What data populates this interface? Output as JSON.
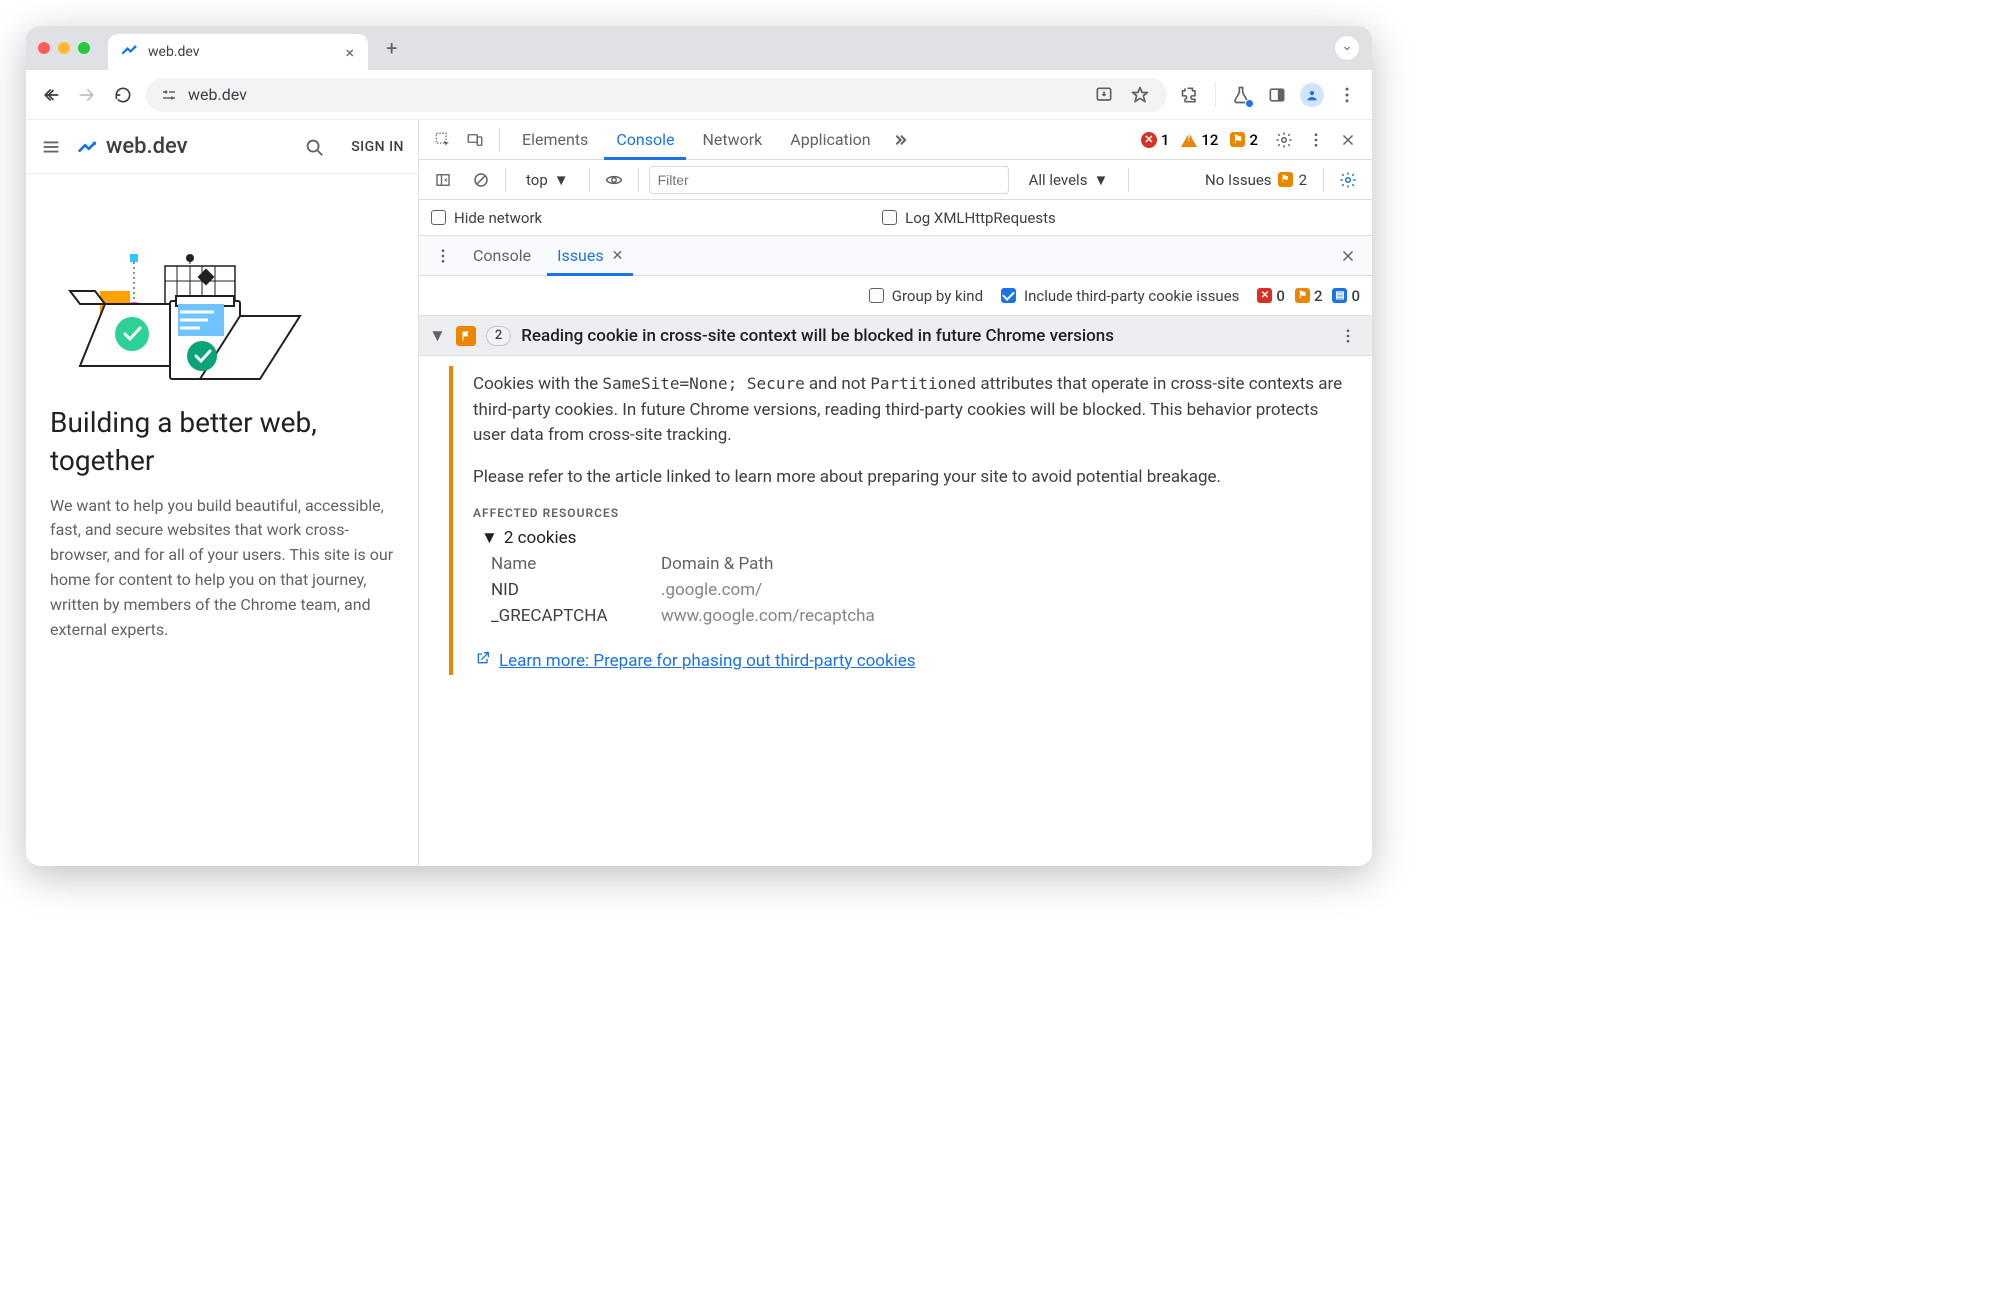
{
  "tab": {
    "title": "web.dev",
    "close": "×"
  },
  "omnibox": {
    "url": "web.dev"
  },
  "page": {
    "brand": "web.dev",
    "signin": "SIGN IN",
    "heading": "Building a better web, together",
    "body": "We want to help you build beautiful, accessible, fast, and secure websites that work cross-browser, and for all of your users. This site is our home for content to help you on that journey, written by members of the Chrome team, and external experts."
  },
  "devtools": {
    "tabs": {
      "elements": "Elements",
      "console": "Console",
      "network": "Network",
      "application": "Application"
    },
    "status": {
      "errors": "1",
      "warnings": "12",
      "flags": "2"
    },
    "filterbar": {
      "context": "top",
      "placeholder": "Filter",
      "levels": "All levels",
      "noissues": "No Issues",
      "noissues_count": "2"
    },
    "checks": {
      "hide_network": "Hide network",
      "log_xhr": "Log XMLHttpRequests"
    },
    "drawer": {
      "console": "Console",
      "issues": "Issues"
    },
    "issues_toolbar": {
      "group": "Group by kind",
      "thirdparty": "Include third-party cookie issues",
      "red": "0",
      "orange": "2",
      "blue": "0"
    },
    "issue": {
      "count": "2",
      "title": "Reading cookie in cross-site context will be blocked in future Chrome versions",
      "p1_a": "Cookies with the ",
      "p1_code1": "SameSite=None; Secure",
      "p1_b": " and not ",
      "p1_code2": "Partitioned",
      "p1_c": " attributes that operate in cross-site contexts are third-party cookies. In future Chrome versions, reading third-party cookies will be blocked. This behavior protects user data from cross-site tracking.",
      "p2": "Please refer to the article linked to learn more about preparing your site to avoid potential breakage.",
      "affected_label": "AFFECTED RESOURCES",
      "cookies_toggle": "2 cookies",
      "col_name": "Name",
      "col_domain": "Domain & Path",
      "rows": [
        {
          "name": "NID",
          "domain": ".google.com/"
        },
        {
          "name": "_GRECAPTCHA",
          "domain": "www.google.com/recaptcha"
        }
      ],
      "learn_label": "Learn more: Prepare for phasing out third-party cookies"
    }
  }
}
